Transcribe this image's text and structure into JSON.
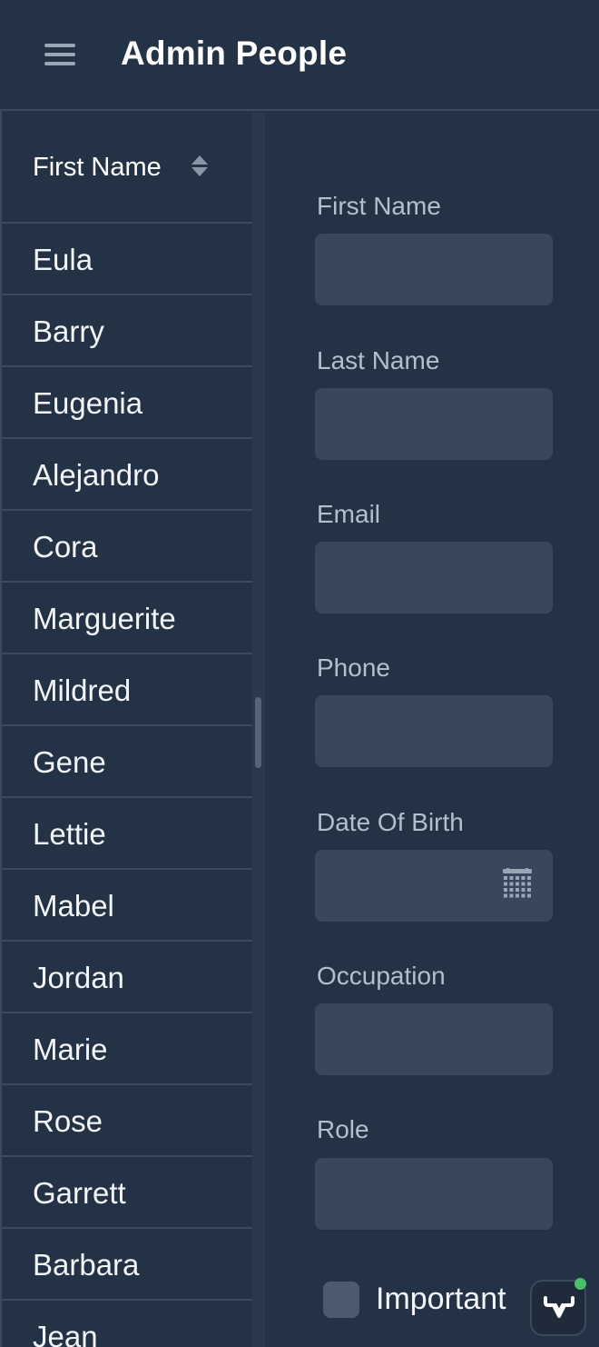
{
  "header": {
    "title": "Admin People",
    "menu_icon": "menu-icon"
  },
  "grid": {
    "column_header": "First Name",
    "sort_icon": "sort-icon",
    "rows": [
      {
        "first_name": "Eula"
      },
      {
        "first_name": "Barry"
      },
      {
        "first_name": "Eugenia"
      },
      {
        "first_name": "Alejandro"
      },
      {
        "first_name": "Cora"
      },
      {
        "first_name": "Marguerite"
      },
      {
        "first_name": "Mildred"
      },
      {
        "first_name": "Gene"
      },
      {
        "first_name": "Lettie"
      },
      {
        "first_name": "Mabel"
      },
      {
        "first_name": "Jordan"
      },
      {
        "first_name": "Marie"
      },
      {
        "first_name": "Rose"
      },
      {
        "first_name": "Garrett"
      },
      {
        "first_name": "Barbara"
      },
      {
        "first_name": "Jean"
      }
    ]
  },
  "form": {
    "first_name": {
      "label": "First Name",
      "value": ""
    },
    "last_name": {
      "label": "Last Name",
      "value": ""
    },
    "email": {
      "label": "Email",
      "value": ""
    },
    "phone": {
      "label": "Phone",
      "value": ""
    },
    "date_of_birth": {
      "label": "Date Of Birth",
      "value": "",
      "icon": "calendar-icon"
    },
    "occupation": {
      "label": "Occupation",
      "value": ""
    },
    "role": {
      "label": "Role",
      "value": ""
    },
    "important": {
      "label": "Important",
      "checked": false
    }
  },
  "dev_tools": {
    "icon": "vaadin-logo-icon",
    "status_color": "#49c06a"
  },
  "colors": {
    "background": "#243246",
    "input_background": "#38475c",
    "divider": "#3a4a5f",
    "label_text": "#b5bfcc"
  }
}
